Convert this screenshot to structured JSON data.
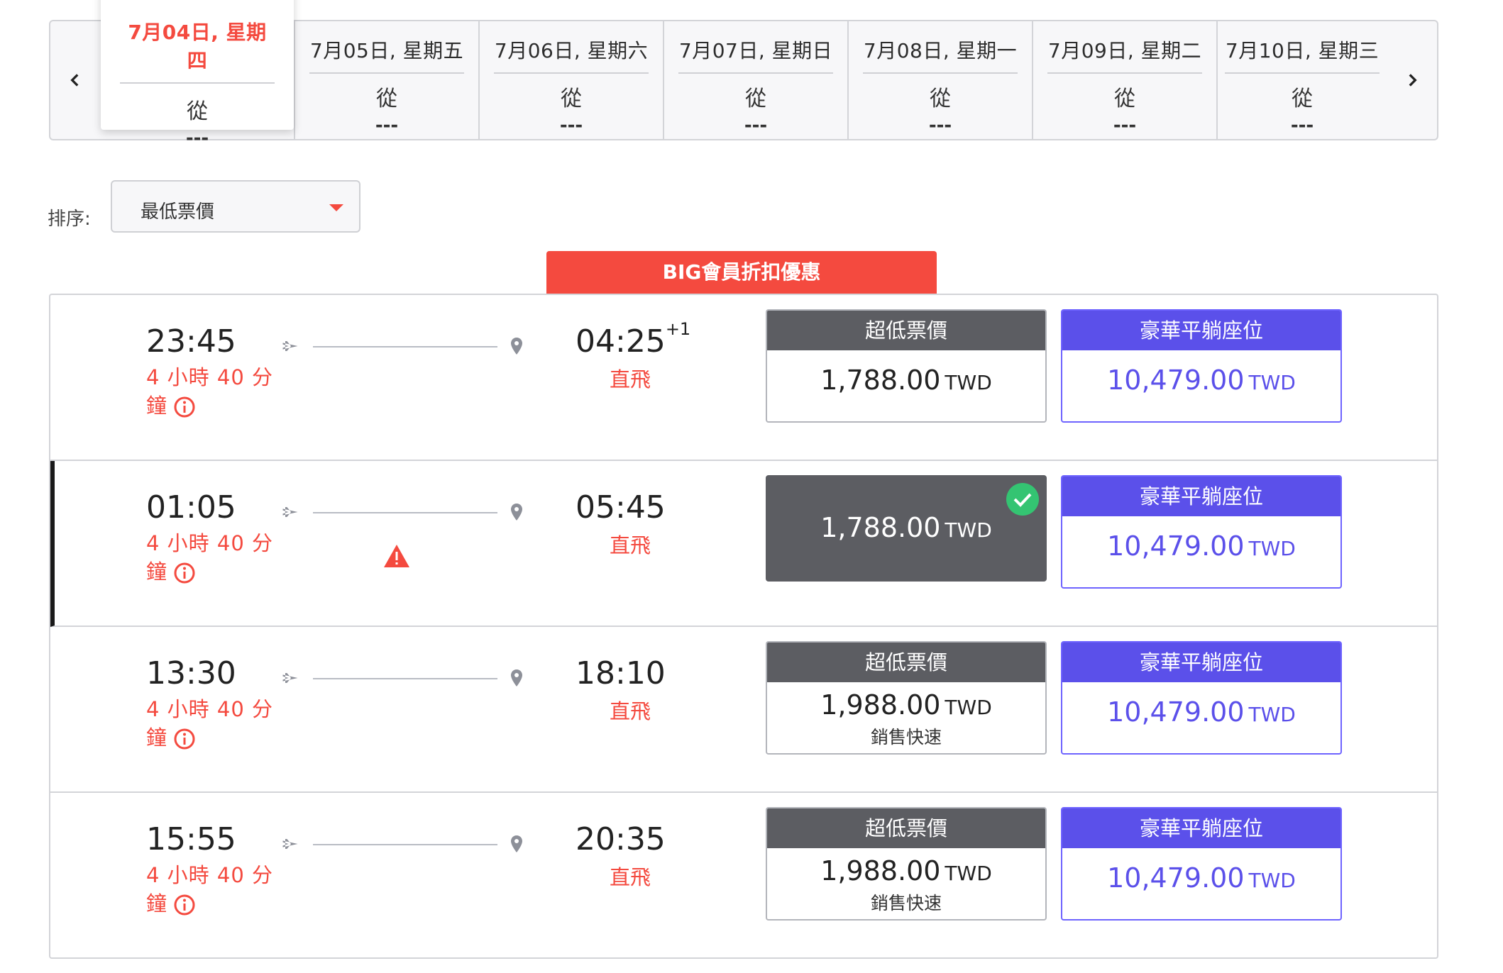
{
  "date_strip": {
    "tabs": [
      {
        "label": "7月04日, 星期四",
        "from": "從",
        "price": "---",
        "active": true
      },
      {
        "label": "7月05日, 星期五",
        "from": "從",
        "price": "---"
      },
      {
        "label": "7月06日, 星期六",
        "from": "從",
        "price": "---"
      },
      {
        "label": "7月07日, 星期日",
        "from": "從",
        "price": "---"
      },
      {
        "label": "7月08日, 星期一",
        "from": "從",
        "price": "---"
      },
      {
        "label": "7月09日, 星期二",
        "from": "從",
        "price": "---"
      },
      {
        "label": "7月10日, 星期三",
        "from": "從",
        "price": "---"
      }
    ]
  },
  "sort": {
    "label": "排序:",
    "value": "最低票價"
  },
  "promo": {
    "banner": "BIG會員折扣優惠"
  },
  "colors": {
    "accent": "#f44a3f",
    "premium": "#5b50ea",
    "fare_dark": "#5c5d62",
    "check": "#34c472"
  },
  "flights": [
    {
      "dep": "23:45",
      "duration": "4 小時 40 分鐘",
      "arr": "04:25",
      "arr_sup": "+1",
      "stops": "直飛",
      "low": {
        "title": "超低票價",
        "amount": "1,788.00",
        "currency": "TWD",
        "note": ""
      },
      "premium": {
        "title": "豪華平躺座位",
        "amount": "10,479.00",
        "currency": "TWD"
      }
    },
    {
      "dep": "01:05",
      "duration": "4 小時 40 分鐘",
      "arr": "05:45",
      "arr_sup": "",
      "stops": "直飛",
      "warning": true,
      "selected": true,
      "low": {
        "title": "",
        "amount": "1,788.00",
        "currency": "TWD",
        "note": "",
        "selected": true
      },
      "premium": {
        "title": "豪華平躺座位",
        "amount": "10,479.00",
        "currency": "TWD"
      }
    },
    {
      "dep": "13:30",
      "duration": "4 小時 40 分鐘",
      "arr": "18:10",
      "arr_sup": "",
      "stops": "直飛",
      "low": {
        "title": "超低票價",
        "amount": "1,988.00",
        "currency": "TWD",
        "note": "銷售快速"
      },
      "premium": {
        "title": "豪華平躺座位",
        "amount": "10,479.00",
        "currency": "TWD"
      }
    },
    {
      "dep": "15:55",
      "duration": "4 小時 40 分鐘",
      "arr": "20:35",
      "arr_sup": "",
      "stops": "直飛",
      "low": {
        "title": "超低票價",
        "amount": "1,988.00",
        "currency": "TWD",
        "note": "銷售快速"
      },
      "premium": {
        "title": "豪華平躺座位",
        "amount": "10,479.00",
        "currency": "TWD"
      }
    }
  ]
}
